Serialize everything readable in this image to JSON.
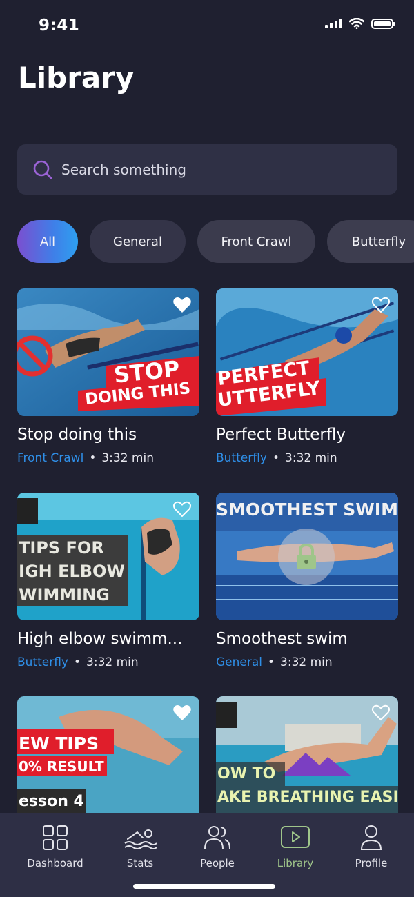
{
  "status_bar": {
    "time": "9:41"
  },
  "page": {
    "title": "Library"
  },
  "search": {
    "placeholder": "Search something"
  },
  "filters": [
    {
      "label": "All",
      "selected": true
    },
    {
      "label": "General",
      "selected": false
    },
    {
      "label": "Front Crawl",
      "selected": false
    },
    {
      "label": "Butterfly",
      "selected": false
    }
  ],
  "videos": [
    {
      "title": "Stop doing this",
      "category": "Front Crawl",
      "duration": "3:32 min",
      "favorite": true,
      "locked": false,
      "overlay_lines": [
        "STOP",
        "DOING THIS"
      ]
    },
    {
      "title": "Perfect Butterfly",
      "category": "Butterfly",
      "duration": "3:32 min",
      "favorite": false,
      "locked": false,
      "overlay_lines": [
        "PERFECT",
        "UTTERFLY"
      ]
    },
    {
      "title": "High elbow swimm...",
      "category": "Butterfly",
      "duration": "3:32 min",
      "favorite": false,
      "locked": false,
      "overlay_lines": [
        "TIPS FOR",
        "IGH ELBOW",
        "WIMMING"
      ]
    },
    {
      "title": "Smoothest swim",
      "category": "General",
      "duration": "3:32 min",
      "favorite": false,
      "locked": true,
      "overlay_lines": [
        "SMOOTHEST SWIM"
      ]
    },
    {
      "title": "",
      "category": "",
      "duration": "",
      "favorite": true,
      "locked": false,
      "overlay_lines": [
        "EW TIPS",
        "0% RESULT",
        "esson 4"
      ]
    },
    {
      "title": "",
      "category": "",
      "duration": "",
      "favorite": false,
      "locked": false,
      "overlay_lines": [
        "OW TO",
        "AKE BREATHING EASIE"
      ]
    }
  ],
  "meta_separator": "•",
  "nav": [
    {
      "label": "Dashboard",
      "icon": "grid-icon",
      "active": false
    },
    {
      "label": "Stats",
      "icon": "swimmer-icon",
      "active": false
    },
    {
      "label": "People",
      "icon": "people-icon",
      "active": false
    },
    {
      "label": "Library",
      "icon": "play-icon",
      "active": true
    },
    {
      "label": "Profile",
      "icon": "user-icon",
      "active": false
    }
  ],
  "colors": {
    "background": "#1f2030",
    "accent_category": "#2f8fe8",
    "nav_active": "#9fc58a",
    "chip_gradient_start": "#7a4fd0",
    "chip_gradient_end": "#2ea0f0"
  }
}
